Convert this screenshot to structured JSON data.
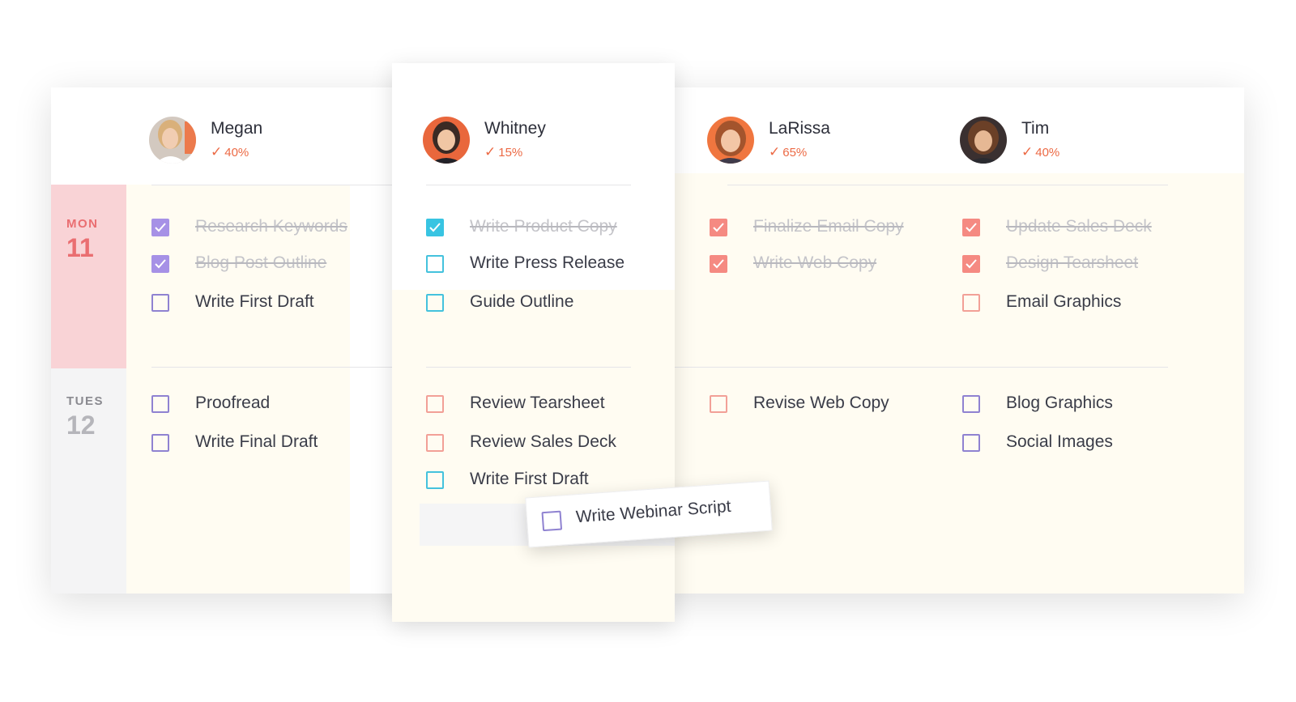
{
  "days": [
    {
      "label": "MON",
      "number": "11"
    },
    {
      "label": "TUES",
      "number": "12"
    }
  ],
  "people": [
    {
      "name": "Megan",
      "percent": "40%",
      "monday": [
        {
          "text": "Research Keywords",
          "done": true
        },
        {
          "text": "Blog Post Outline",
          "done": true
        },
        {
          "text": "Write First Draft",
          "done": false
        }
      ],
      "tuesday": [
        {
          "text": "Proofread",
          "done": false
        },
        {
          "text": "Write Final Draft",
          "done": false
        }
      ]
    },
    {
      "name": "Whitney",
      "percent": "15%",
      "monday": [
        {
          "text": "Write Product Copy",
          "done": true
        },
        {
          "text": "Write Press Release",
          "done": false
        },
        {
          "text": "Guide Outline",
          "done": false
        }
      ],
      "tuesday": [
        {
          "text": "Review Tearsheet",
          "done": false
        },
        {
          "text": "Review Sales Deck",
          "done": false
        },
        {
          "text": "Write First Draft",
          "done": false
        }
      ]
    },
    {
      "name": "LaRissa",
      "percent": "65%",
      "monday": [
        {
          "text": "Finalize Email Copy",
          "done": true
        },
        {
          "text": "Write Web Copy",
          "done": true
        }
      ],
      "tuesday": [
        {
          "text": "Revise Web Copy",
          "done": false
        }
      ]
    },
    {
      "name": "Tim",
      "percent": "40%",
      "monday": [
        {
          "text": "Update Sales Deck",
          "done": true
        },
        {
          "text": "Design Tearsheet",
          "done": true
        },
        {
          "text": "Email Graphics",
          "done": false
        }
      ],
      "tuesday": [
        {
          "text": "Blog Graphics",
          "done": false
        },
        {
          "text": "Social Images",
          "done": false
        }
      ]
    }
  ],
  "dragging_task": {
    "text": "Write Webinar Script",
    "done": false
  },
  "icons": {
    "check": "check-icon",
    "avatar": "avatar-photo"
  },
  "colors": {
    "percent": "#ec6a45",
    "megan_check": "#a691e6",
    "whitney_check": "#38c4e2",
    "larissa_check": "#f58a82",
    "tim_check": "#f58a82",
    "monday_highlight": "#f9d3d6",
    "background_tint": "#fffcf2"
  }
}
